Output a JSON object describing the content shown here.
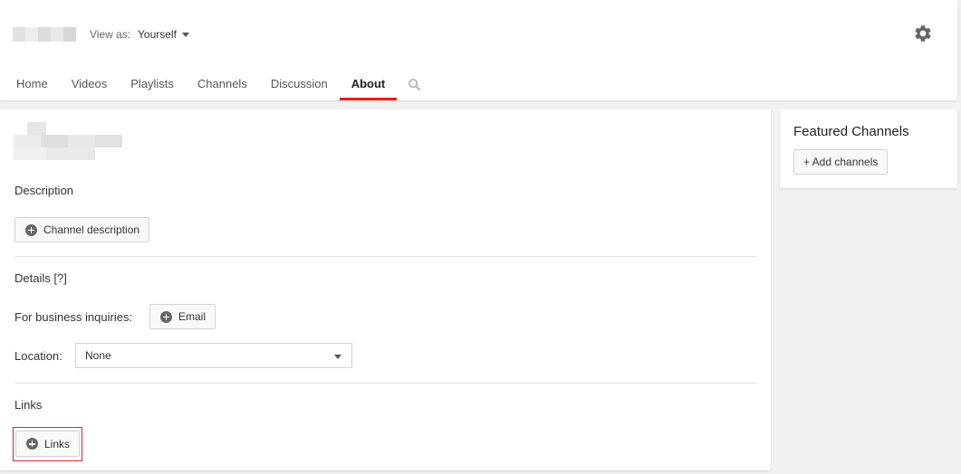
{
  "header": {
    "view_as_label": "View as:",
    "view_as_value": "Yourself",
    "settings_icon": "gear-icon"
  },
  "tabs": [
    {
      "label": "Home",
      "active": false
    },
    {
      "label": "Videos",
      "active": false
    },
    {
      "label": "Playlists",
      "active": false
    },
    {
      "label": "Channels",
      "active": false
    },
    {
      "label": "Discussion",
      "active": false
    },
    {
      "label": "About",
      "active": true
    }
  ],
  "search_icon": "search-icon",
  "about": {
    "description_label": "Description",
    "channel_description_button": "Channel description",
    "details_label": "Details [?]",
    "business_label": "For business inquiries:",
    "email_button": "Email",
    "location_label": "Location:",
    "location_value": "None",
    "links_label": "Links",
    "links_button": "Links"
  },
  "featured": {
    "title": "Featured Channels",
    "add_button": "+ Add channels"
  },
  "colors": {
    "accent_red": "#e62117",
    "highlight_red": "#d9262c",
    "background": "#f1f1f1"
  }
}
